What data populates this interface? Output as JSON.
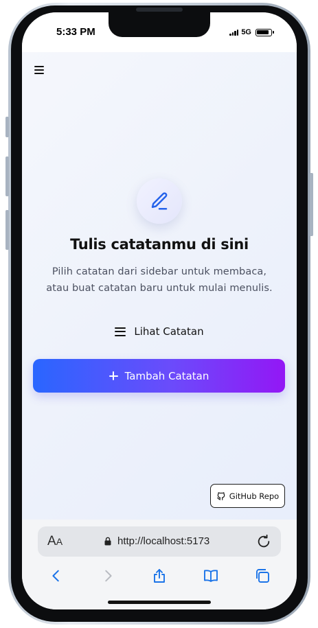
{
  "status_bar": {
    "time": "5:33 PM",
    "network": "5G"
  },
  "page": {
    "headline": "Tulis catatanmu di sini",
    "description_line1": "Pilih catatan dari sidebar untuk membaca,",
    "description_line2": "atau buat catatan baru untuk mulai menulis.",
    "view_notes_label": "Lihat Catatan",
    "add_note_label": "Tambah Catatan",
    "github_label": "GitHub Repo"
  },
  "browser": {
    "aa_big": "A",
    "aa_small": "A",
    "url": "http://localhost:5173"
  },
  "icons": [
    "menu-icon",
    "pen-icon",
    "list-icon",
    "plus-icon",
    "github-icon",
    "lock-icon",
    "reload-icon",
    "back-icon",
    "forward-icon",
    "share-icon",
    "bookmarks-icon",
    "tabs-icon"
  ],
  "colors": {
    "accent_start": "#2a66ff",
    "accent_end": "#9317f5",
    "ios_blue": "#1a73e8"
  }
}
